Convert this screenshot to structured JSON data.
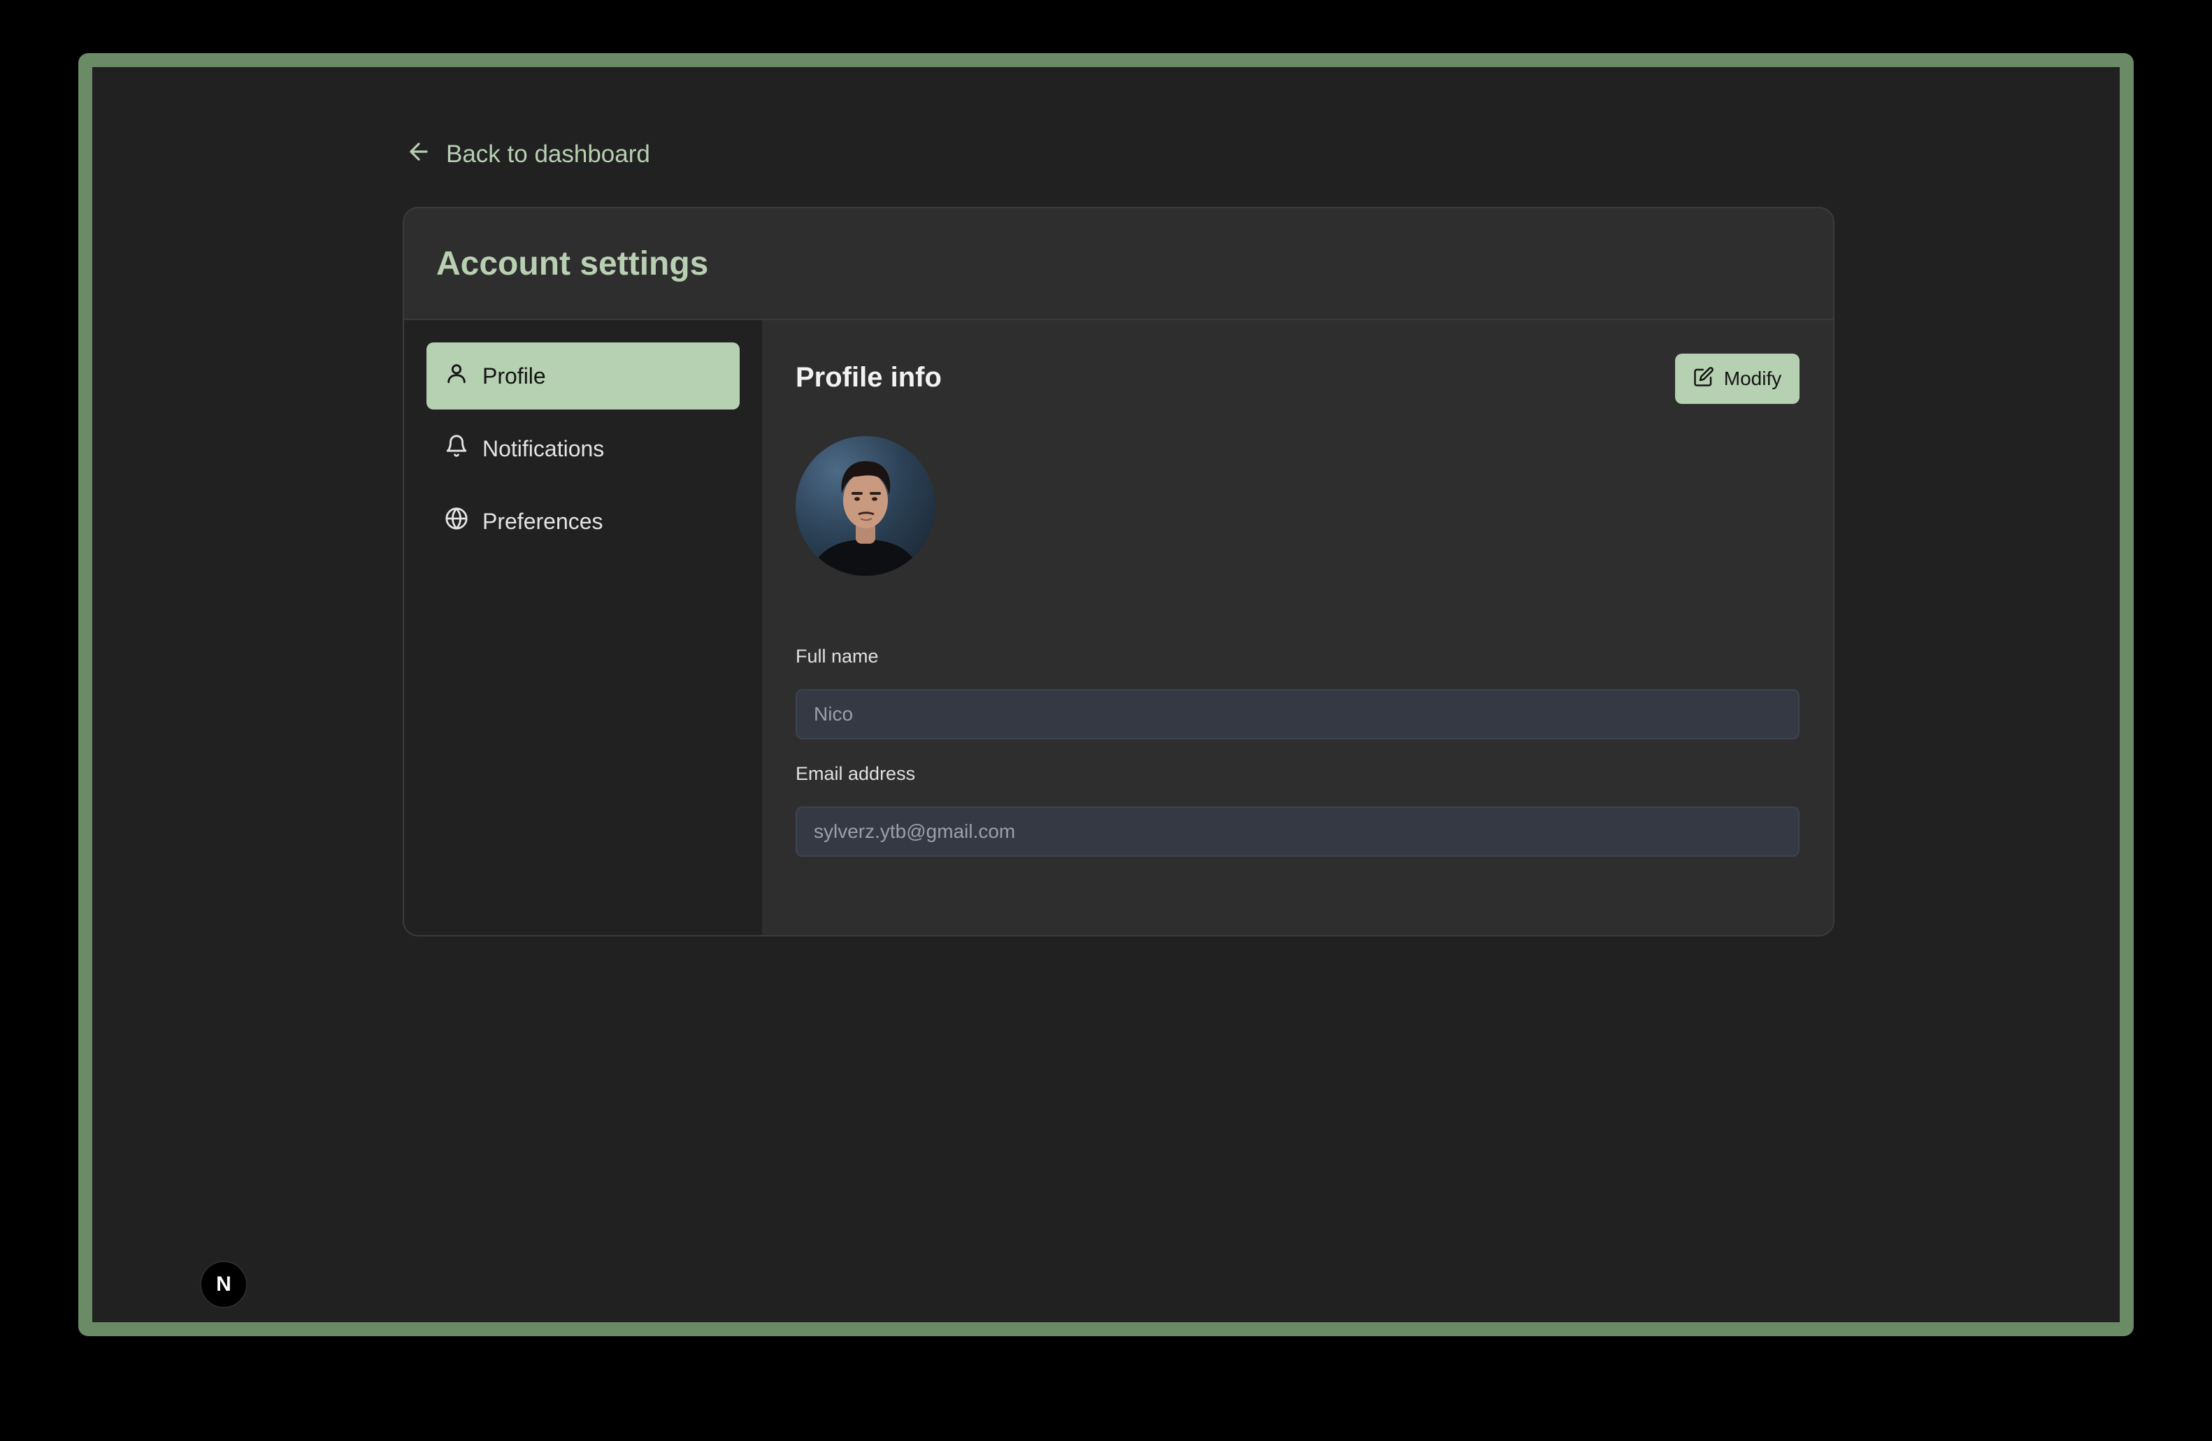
{
  "back_link": {
    "label": "Back to dashboard",
    "icon": "arrow-left-icon"
  },
  "card": {
    "title": "Account settings"
  },
  "sidebar": {
    "items": [
      {
        "label": "Profile",
        "icon": "user-icon",
        "active": true
      },
      {
        "label": "Notifications",
        "icon": "bell-icon",
        "active": false
      },
      {
        "label": "Preferences",
        "icon": "globe-icon",
        "active": false
      }
    ]
  },
  "profile": {
    "title": "Profile info",
    "modify_label": "Modify",
    "modify_icon": "edit-icon",
    "full_name": {
      "label": "Full name",
      "placeholder": "Nico"
    },
    "email": {
      "label": "Email address",
      "placeholder": "sylverz.ytb@gmail.com"
    }
  },
  "badge": {
    "label": "N"
  },
  "colors": {
    "accent": "#b6d1b1",
    "accent_text": "#b8cfb2",
    "frame_border": "#6b8b66",
    "background": "#212121",
    "card": "#2e2e2e",
    "input": "#343943"
  }
}
